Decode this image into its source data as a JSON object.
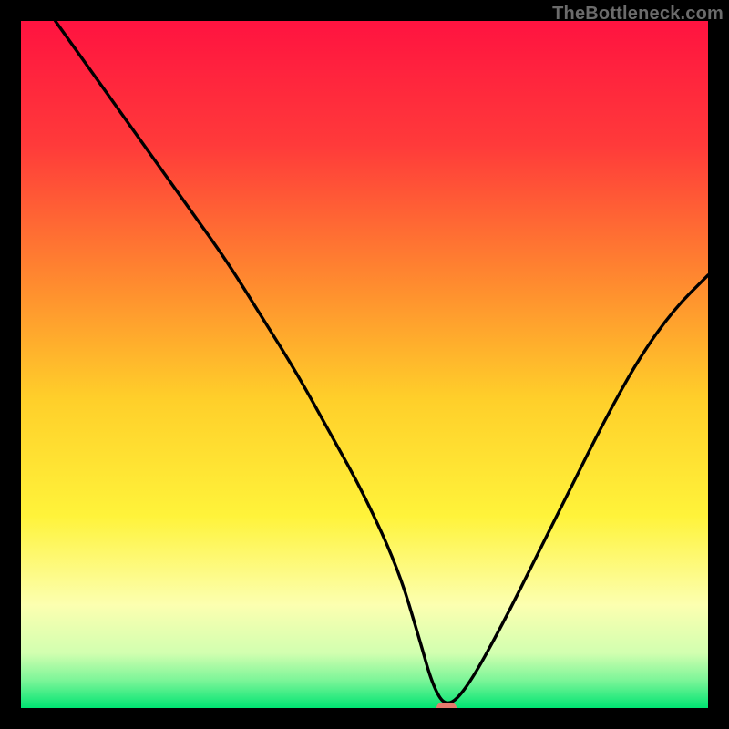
{
  "watermark": "TheBottleneck.com",
  "chart_data": {
    "type": "line",
    "title": "",
    "xlabel": "",
    "ylabel": "",
    "xlim": [
      0,
      100
    ],
    "ylim": [
      0,
      100
    ],
    "grid": false,
    "legend": false,
    "x": [
      5,
      10,
      15,
      20,
      25,
      30,
      35,
      40,
      45,
      50,
      55,
      58,
      60,
      62,
      65,
      70,
      75,
      80,
      85,
      90,
      95,
      100
    ],
    "values": [
      100,
      93,
      86,
      79,
      72,
      65,
      57,
      49,
      40,
      31,
      20,
      10,
      3,
      0,
      3,
      12,
      22,
      32,
      42,
      51,
      58,
      63
    ],
    "minimum": {
      "x": 62,
      "y": 0
    },
    "gradient_stops": [
      {
        "pos": 0.0,
        "color": "#ff1340"
      },
      {
        "pos": 0.18,
        "color": "#ff3a3a"
      },
      {
        "pos": 0.38,
        "color": "#ff8a2f"
      },
      {
        "pos": 0.55,
        "color": "#ffcf2a"
      },
      {
        "pos": 0.72,
        "color": "#fff33a"
      },
      {
        "pos": 0.85,
        "color": "#fcffb0"
      },
      {
        "pos": 0.92,
        "color": "#d2ffb0"
      },
      {
        "pos": 0.96,
        "color": "#7bf598"
      },
      {
        "pos": 1.0,
        "color": "#00e472"
      }
    ],
    "marker": {
      "color": "#e77a6d",
      "x": 62,
      "y": 0
    }
  }
}
